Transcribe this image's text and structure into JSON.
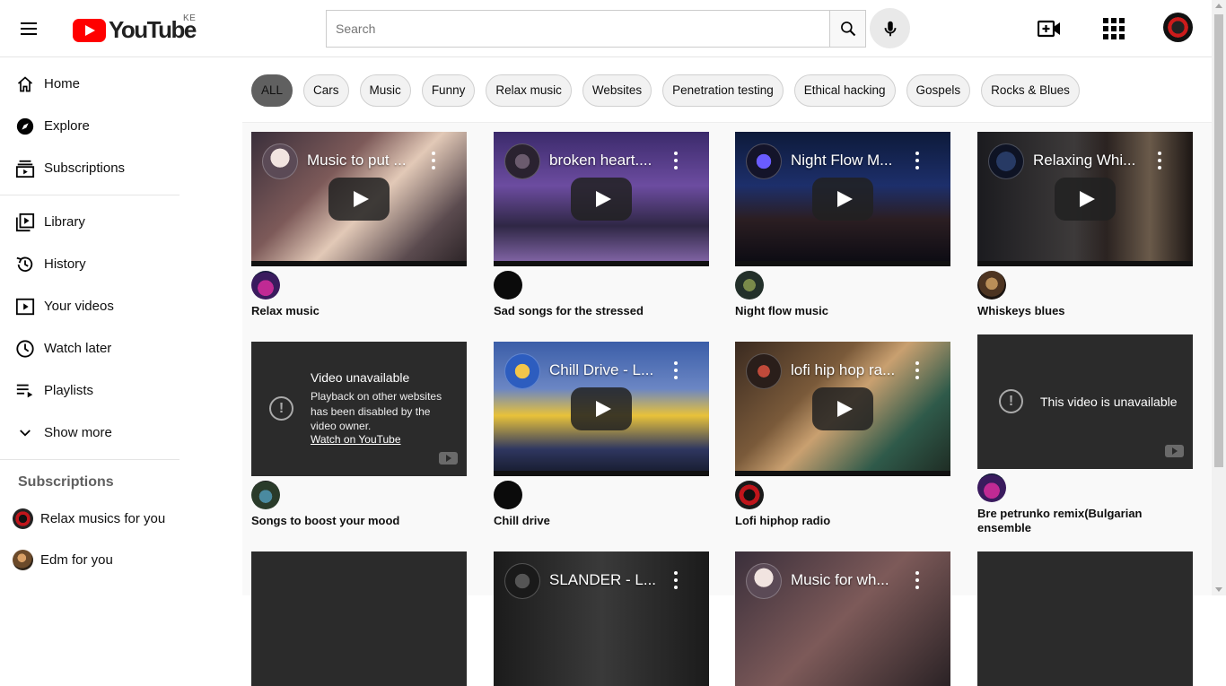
{
  "header": {
    "logo_text": "YouTube",
    "region": "KE",
    "search_placeholder": "Search"
  },
  "sidebar": {
    "items": [
      {
        "label": "Home",
        "icon": "home-icon"
      },
      {
        "label": "Explore",
        "icon": "compass-icon"
      },
      {
        "label": "Subscriptions",
        "icon": "subscriptions-icon"
      }
    ],
    "library_items": [
      {
        "label": "Library",
        "icon": "library-icon"
      },
      {
        "label": "History",
        "icon": "history-icon"
      },
      {
        "label": "Your videos",
        "icon": "your-videos-icon"
      },
      {
        "label": "Watch later",
        "icon": "clock-icon"
      },
      {
        "label": "Playlists",
        "icon": "playlist-icon"
      },
      {
        "label": "Show more",
        "icon": "chevron-down-icon"
      }
    ],
    "subscriptions_heading": "Subscriptions",
    "subscriptions": [
      {
        "name": "Relax musics for you"
      },
      {
        "name": "Edm for you"
      }
    ]
  },
  "chips": [
    "ALL",
    "Cars",
    "Music",
    "Funny",
    "Relax music",
    "Websites",
    "Penetration testing",
    "Ethical hacking",
    "Gospels",
    "Rocks & Blues"
  ],
  "videos": [
    {
      "overlay_title": "Music to put ...",
      "title": "Relax music"
    },
    {
      "overlay_title": "broken heart....",
      "title": "Sad songs for the stressed"
    },
    {
      "overlay_title": "Night Flow M...",
      "title": "Night flow music"
    },
    {
      "overlay_title": "Relaxing Whi...",
      "title": "Whiskeys blues"
    },
    {
      "overlay_title": "",
      "title": "Songs to boost your mood"
    },
    {
      "overlay_title": "Chill Drive - L...",
      "title": "Chill drive"
    },
    {
      "overlay_title": "lofi hip hop ra...",
      "title": "Lofi hiphop radio"
    },
    {
      "overlay_title": "",
      "title": "Bre petrunko remix(Bulgarian ensemble"
    },
    {
      "overlay_title": "",
      "title": ""
    },
    {
      "overlay_title": "SLANDER - L...",
      "title": ""
    },
    {
      "overlay_title": "Music for wh...",
      "title": ""
    },
    {
      "overlay_title": "",
      "title": ""
    }
  ],
  "unavailable_embed": {
    "title": "Video unavailable",
    "message": "Playback on other websites has been disabled by the video owner.",
    "link": "Watch on YouTube"
  },
  "unavailable_simple": {
    "message": "This video is unavailable"
  },
  "colors": {
    "brand_red": "#ff0000",
    "active_chip": "#606060",
    "unavailable_bg": "#2b2b2b"
  }
}
